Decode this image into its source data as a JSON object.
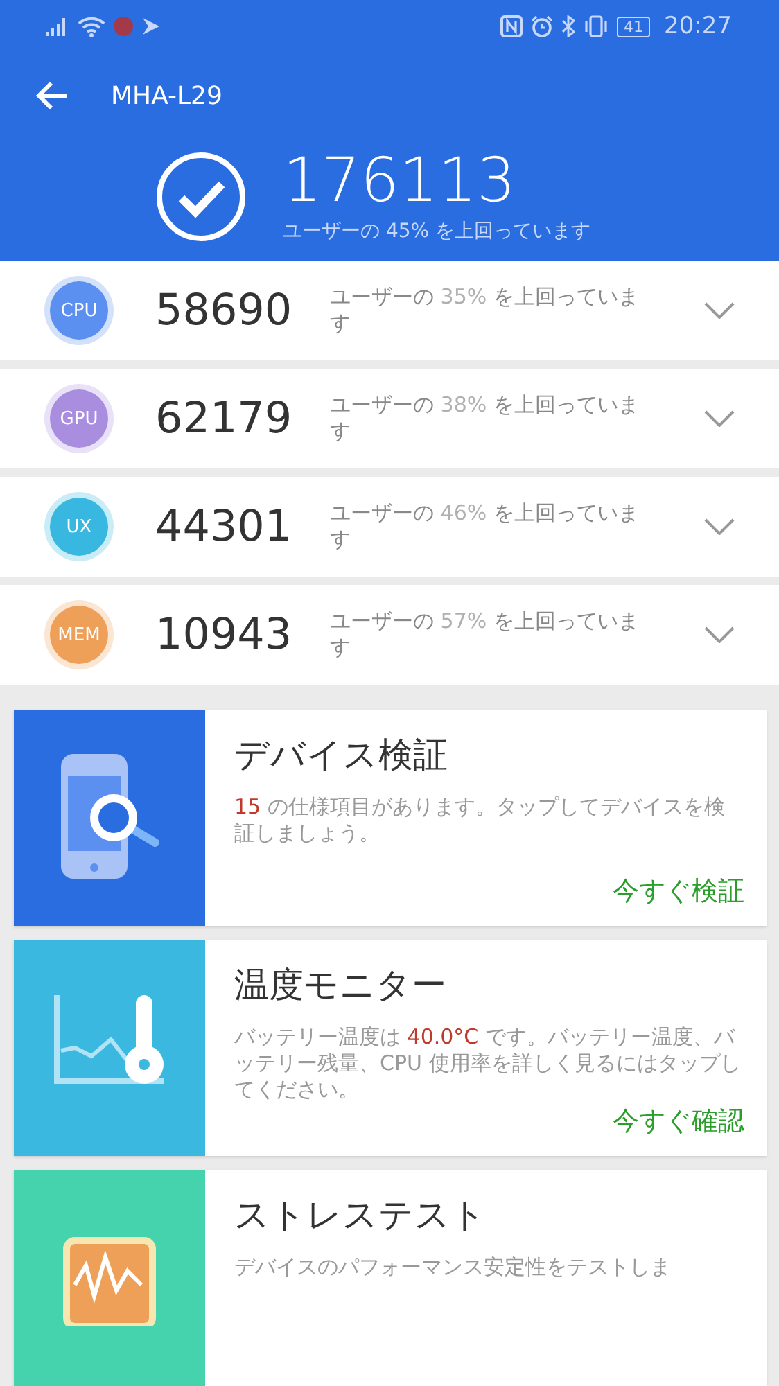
{
  "status_bar": {
    "battery": "41",
    "time": "20:27"
  },
  "header": {
    "title": "MHA-L29",
    "total_score": "176113",
    "total_caption": "ユーザーの 45% を上回っています"
  },
  "scores": [
    {
      "label": "CPU",
      "color": "#5b8ff0",
      "score": "58690",
      "caption": [
        {
          "text": "ユーザーの ",
          "muted": false
        },
        {
          "text": "35%",
          "muted": true
        },
        {
          "text": " を上回っています",
          "muted": false
        }
      ],
      "expanded": false
    },
    {
      "label": "GPU",
      "color": "#a98ee0",
      "score": "62179",
      "caption": [
        {
          "text": "ユーザーの ",
          "muted": false
        },
        {
          "text": "38%",
          "muted": true
        },
        {
          "text": " を上回っています",
          "muted": false
        }
      ],
      "expanded": false
    },
    {
      "label": "UX",
      "color": "#38b8e0",
      "score": "44301",
      "caption": [
        {
          "text": "ユーザーの ",
          "muted": false
        },
        {
          "text": "46%",
          "muted": true
        },
        {
          "text": " を上回っています",
          "muted": false
        }
      ],
      "expanded": false
    },
    {
      "label": "MEM",
      "color": "#eea059",
      "score": "10943",
      "caption": [
        {
          "text": "ユーザーの ",
          "muted": false
        },
        {
          "text": "57%",
          "muted": true
        },
        {
          "text": " を上回っています",
          "muted": false
        }
      ],
      "expanded": false
    }
  ],
  "cards": [
    {
      "kind": "verify",
      "color": "#2a6de0",
      "title": "デバイス検証",
      "description": [
        {
          "text": "15",
          "highlight": true
        },
        {
          "text": " の仕様項目があります。タップしてデバイスを検証しましょう。",
          "highlight": false
        }
      ],
      "action": "今すぐ検証"
    },
    {
      "kind": "temperature",
      "color": "#3bb8e0",
      "title": "温度モニター",
      "description": [
        {
          "text": "バッテリー温度は ",
          "highlight": false
        },
        {
          "text": "40.0°C",
          "highlight": true
        },
        {
          "text": " です。バッテリー温度、バッテリー残量、CPU 使用率を詳しく見るにはタップしてください。",
          "highlight": false
        }
      ],
      "action": "今すぐ確認"
    },
    {
      "kind": "stress",
      "color": "#44d3ad",
      "title": "ストレステスト",
      "description": [
        {
          "text": "デバイスのパフォーマンス安定性をテストしま",
          "highlight": false
        }
      ]
    }
  ]
}
